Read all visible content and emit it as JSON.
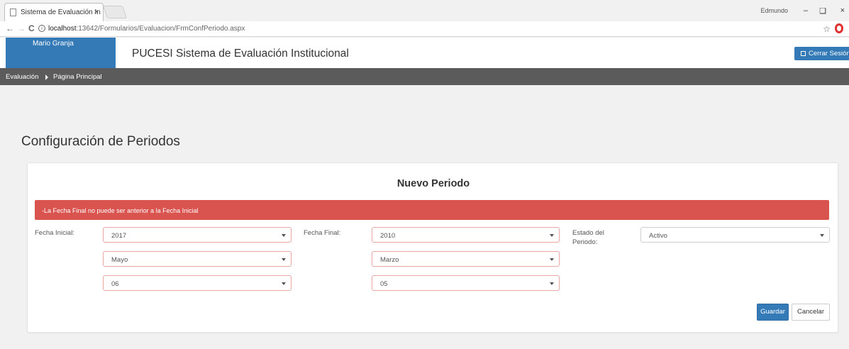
{
  "browser": {
    "tab_title": "Sistema de Evaluación In",
    "tab_close": "×",
    "url_host": "localhost",
    "url_path": ":13642/Formularios/Evaluacion/FrmConfPeriodo.aspx",
    "window_user": "Edmundo",
    "nav_back": "←",
    "nav_forward": "→",
    "nav_reload": "C",
    "star": "☆"
  },
  "header": {
    "user_name": "Mario Granja",
    "app_title": "PUCESI Sistema de Evaluación Institucional",
    "logout_label": "Cerrar Sesión"
  },
  "nav": {
    "items": [
      {
        "label": "Evaluación"
      },
      {
        "label": "Página Principal"
      }
    ]
  },
  "page": {
    "title": "Configuración de Periodos"
  },
  "panel": {
    "title": "Nuevo Periodo",
    "alert": "-La Fecha Final no puede ser anterior a la Fecha Inicial",
    "fecha_inicial_label": "Fecha Inicial:",
    "fecha_final_label": "Fecha Final:",
    "estado_label": "Estado del Periodo:",
    "inicial": {
      "year": "2017",
      "month": "Mayo",
      "day": "06"
    },
    "final": {
      "year": "2010",
      "month": "Marzo",
      "day": "05"
    },
    "estado": "Activo",
    "save_label": "Guardar",
    "cancel_label": "Cancelar"
  },
  "colors": {
    "primary": "#337ab7",
    "danger": "#d9534f",
    "nav_bg": "#5b5b5b"
  }
}
